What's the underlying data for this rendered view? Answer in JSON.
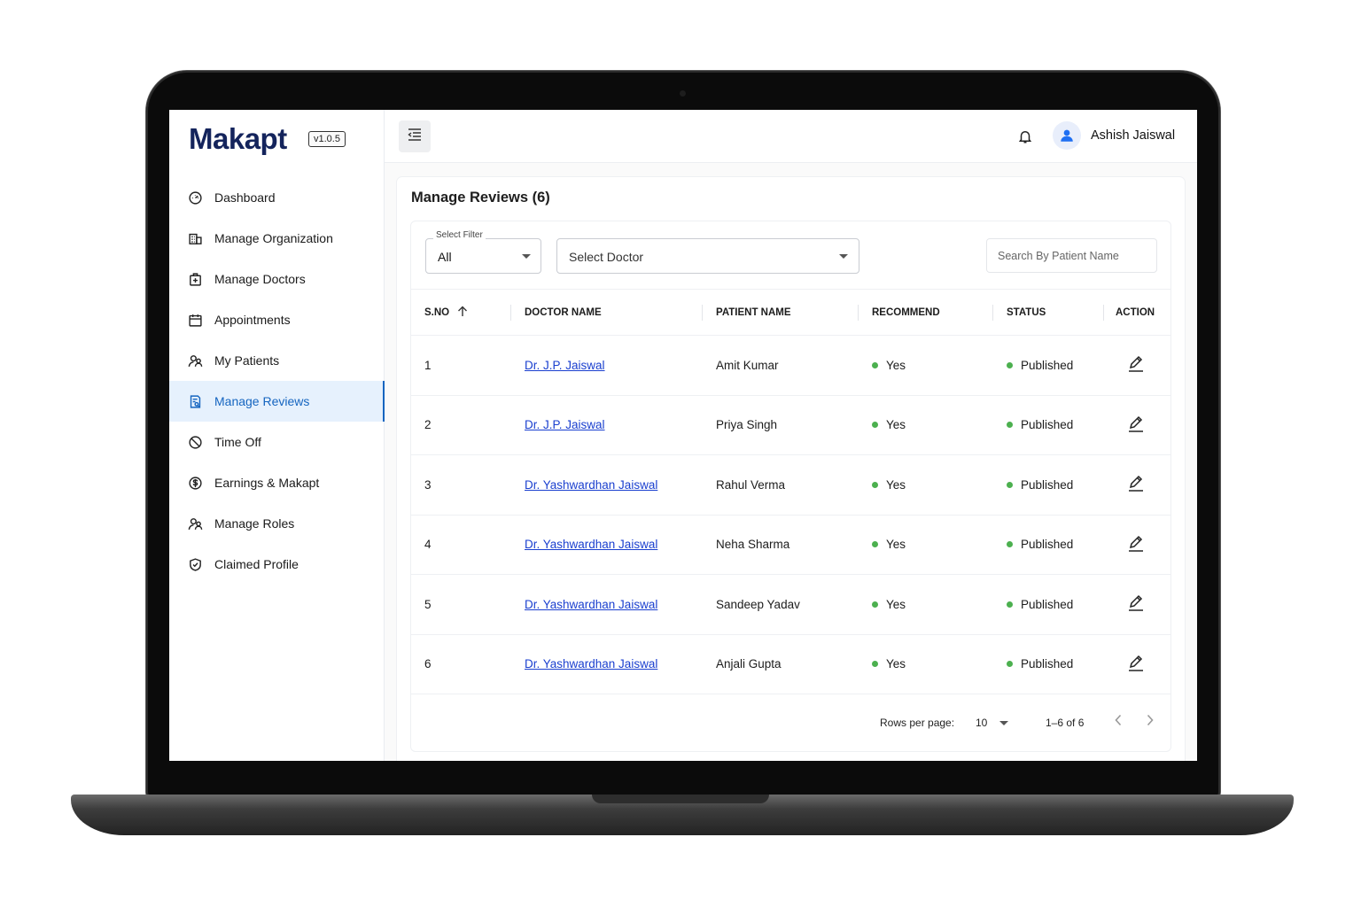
{
  "brand": {
    "name": "Makapt",
    "version": "v1.0.5"
  },
  "sidebar": {
    "items": [
      {
        "label": "Dashboard",
        "icon": "speedometer-icon"
      },
      {
        "label": "Manage Organization",
        "icon": "building-icon"
      },
      {
        "label": "Manage Doctors",
        "icon": "medical-bag-icon"
      },
      {
        "label": "Appointments",
        "icon": "calendar-icon"
      },
      {
        "label": "My Patients",
        "icon": "users-icon"
      },
      {
        "label": "Manage Reviews",
        "icon": "review-icon",
        "active": true
      },
      {
        "label": "Time Off",
        "icon": "block-icon"
      },
      {
        "label": "Earnings & Makapt",
        "icon": "dollar-circle-icon"
      },
      {
        "label": "Manage Roles",
        "icon": "users-icon"
      },
      {
        "label": "Claimed Profile",
        "icon": "shield-check-icon"
      }
    ]
  },
  "header": {
    "user_name": "Ashish Jaiswal"
  },
  "page": {
    "title": "Manage Reviews (6)",
    "filter": {
      "legend": "Select Filter",
      "value": "All"
    },
    "doctor_select": {
      "value": "Select Doctor"
    },
    "search": {
      "placeholder": "Search By Patient Name"
    }
  },
  "table": {
    "columns": [
      "S.NO",
      "DOCTOR NAME",
      "PATIENT NAME",
      "RECOMMEND",
      "STATUS",
      "ACTION"
    ],
    "rows": [
      {
        "sno": "1",
        "doctor": "Dr. J.P. Jaiswal",
        "patient": "Amit Kumar",
        "recommend": "Yes",
        "status": "Published"
      },
      {
        "sno": "2",
        "doctor": "Dr. J.P. Jaiswal",
        "patient": "Priya Singh",
        "recommend": "Yes",
        "status": "Published"
      },
      {
        "sno": "3",
        "doctor": "Dr. Yashwardhan Jaiswal",
        "patient": "Rahul Verma",
        "recommend": "Yes",
        "status": "Published"
      },
      {
        "sno": "4",
        "doctor": "Dr. Yashwardhan Jaiswal",
        "patient": "Neha Sharma",
        "recommend": "Yes",
        "status": "Published"
      },
      {
        "sno": "5",
        "doctor": "Dr. Yashwardhan Jaiswal",
        "patient": "Sandeep Yadav",
        "recommend": "Yes",
        "status": "Published"
      },
      {
        "sno": "6",
        "doctor": "Dr. Yashwardhan Jaiswal",
        "patient": "Anjali Gupta",
        "recommend": "Yes",
        "status": "Published"
      }
    ]
  },
  "pagination": {
    "rows_label": "Rows per page:",
    "rows_value": "10",
    "range": "1–6 of 6"
  },
  "colors": {
    "brand": "#14245c",
    "accent": "#1565c0",
    "link": "#1a3fcf",
    "status_green": "#4cb04f"
  }
}
